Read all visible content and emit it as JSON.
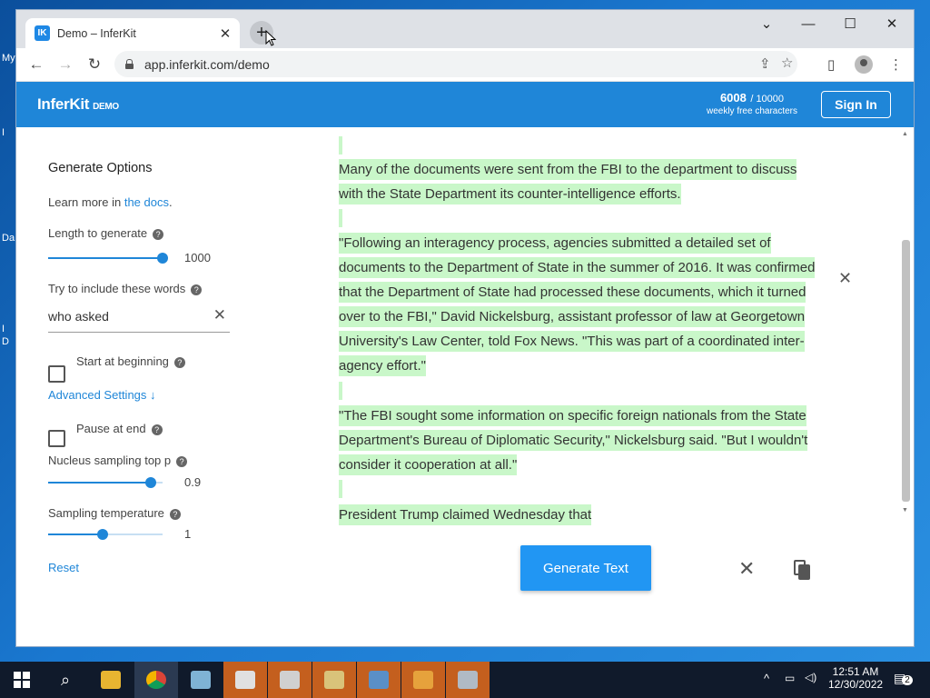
{
  "desktop": {
    "labels": [
      "My",
      "I",
      "Da",
      "I",
      "D"
    ]
  },
  "browser": {
    "tab_title": "Demo – InferKit",
    "tab_favicon": "IK",
    "url": "app.inferkit.com/demo",
    "window_controls": {
      "minimize": "⌄",
      "restore": "—",
      "maximize": "☐",
      "close": "✕"
    }
  },
  "header": {
    "logo": "InferKit",
    "logo_tag": "DEMO",
    "quota_used": "6008",
    "quota_max": "/ 10000",
    "quota_label": "weekly free characters",
    "signin_label": "Sign In"
  },
  "sidebar": {
    "title": "Generate Options",
    "learn_prefix": "Learn more in ",
    "learn_link": "the docs",
    "learn_suffix": ".",
    "length_label": "Length to generate",
    "length_value": "1000",
    "length_fraction": 1.0,
    "words_label": "Try to include these words",
    "words_value": "who asked",
    "start_label": "Start at beginning",
    "start_checked": false,
    "advanced_label": "Advanced Settings ↓",
    "pause_label": "Pause at end",
    "pause_checked": false,
    "nucleus_label": "Nucleus sampling top p",
    "nucleus_value": "0.9",
    "nucleus_fraction": 0.9,
    "temp_label": "Sampling temperature",
    "temp_value": "1",
    "temp_fraction": 0.5,
    "reset_label": "Reset"
  },
  "editor": {
    "paragraphs": [
      "Many of the documents were sent from the FBI to the department to discuss with the State Department its counter-intelligence efforts.",
      "\"Following an interagency process, agencies submitted a detailed set of documents to the Department of State in the summer of 2016. It was confirmed that the Department of State had processed these documents, which it turned over to the FBI,\" David Nickelsburg, assistant professor of law at Georgetown University's Law Center, told Fox News. \"This was part of a coordinated inter-agency effort.\"",
      "\"The FBI sought some information on specific foreign nationals from the State Department's Bureau of Diplomatic Security,\" Nickelsburg said. \"But I wouldn't consider it cooperation at all.\"",
      "President Trump claimed Wednesday that"
    ],
    "highlight_color": "#c9f7c9"
  },
  "actions": {
    "generate_label": "Generate Text"
  },
  "taskbar": {
    "time": "12:51 AM",
    "date": "12/30/2022",
    "notification_count": "2"
  },
  "colors": {
    "brand": "#1f86d8",
    "button": "#2196f3"
  }
}
